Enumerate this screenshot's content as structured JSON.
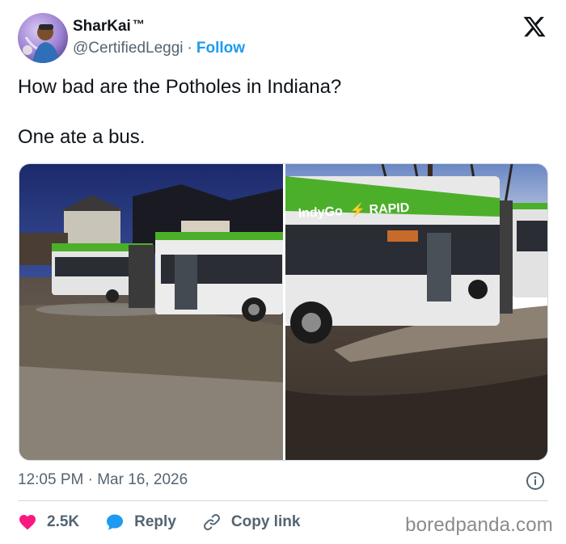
{
  "author": {
    "display_name": "SharKai",
    "tm_mark": "™",
    "handle": "@CertifiedLeggi",
    "separator": "·",
    "follow_label": "Follow"
  },
  "tweet": {
    "text": "How bad are the Potholes in Indiana?\n\nOne ate a bus.",
    "timestamp": "12:05 PM · Mar 16, 2026"
  },
  "media": {
    "bus_brand": "IndyGo",
    "bus_route": "RAPID"
  },
  "actions": {
    "like_count": "2.5K",
    "reply_label": "Reply",
    "copy_link_label": "Copy link"
  },
  "watermark": "boredpanda.com",
  "icons": {
    "brand": "x-logo-icon",
    "like": "heart-icon",
    "reply": "speech-bubble-icon",
    "copy_link": "link-icon",
    "info": "info-icon"
  },
  "colors": {
    "accent": "#1d9bf0",
    "like": "#f91880",
    "text_primary": "#0f1419",
    "text_secondary": "#536471",
    "bus_green": "#4caf2a"
  }
}
